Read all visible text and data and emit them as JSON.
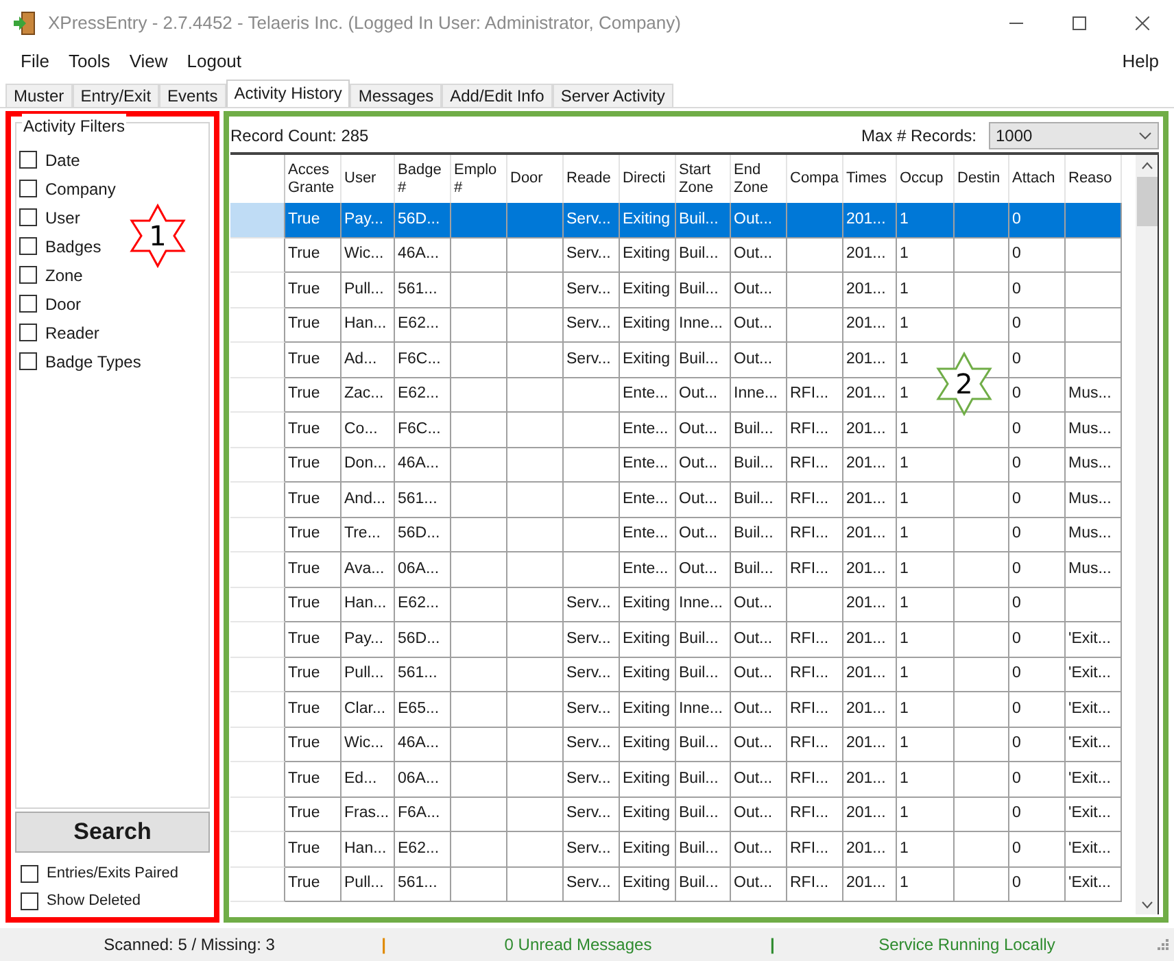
{
  "window": {
    "title": "XPressEntry - 2.7.4452 - Telaeris Inc. (Logged In User: Administrator, Company)"
  },
  "menu": {
    "items": [
      "File",
      "Tools",
      "View",
      "Logout"
    ],
    "help": "Help"
  },
  "tabs": [
    {
      "label": "Muster",
      "selected": false
    },
    {
      "label": "Entry/Exit",
      "selected": false
    },
    {
      "label": "Events",
      "selected": false
    },
    {
      "label": "Activity History",
      "selected": true
    },
    {
      "label": "Messages",
      "selected": false
    },
    {
      "label": "Add/Edit Info",
      "selected": false
    },
    {
      "label": "Server Activity",
      "selected": false
    }
  ],
  "filters": {
    "title": "Activity Filters",
    "items": [
      {
        "label": "Date",
        "checked": false
      },
      {
        "label": "Company",
        "checked": false
      },
      {
        "label": "User",
        "checked": false
      },
      {
        "label": "Badges",
        "checked": false
      },
      {
        "label": "Zone",
        "checked": false
      },
      {
        "label": "Door",
        "checked": false
      },
      {
        "label": "Reader",
        "checked": false
      },
      {
        "label": "Badge Types",
        "checked": false
      }
    ],
    "search_button": "Search",
    "options": [
      {
        "label": "Entries/Exits Paired",
        "checked": false
      },
      {
        "label": "Show Deleted",
        "checked": false
      }
    ]
  },
  "records": {
    "count_label": "Record Count: 285",
    "max_label": "Max # Records:",
    "max_value": "1000"
  },
  "table": {
    "columns": [
      "Acces Grante",
      "User",
      "Badge #",
      "Emplo #",
      "Door",
      "Reade",
      "Directi",
      "Start Zone",
      "End Zone",
      "Compa",
      "Times",
      "Occup",
      "Destin",
      "Attach",
      "Reaso"
    ],
    "rows": [
      {
        "selected": true,
        "cells": [
          "True",
          "Pay...",
          "56D...",
          "",
          "",
          "Serv...",
          "Exiting",
          "Buil...",
          "Out...",
          "",
          "201...",
          "1",
          "",
          "0",
          ""
        ]
      },
      {
        "selected": false,
        "cells": [
          "True",
          "Wic...",
          "46A...",
          "",
          "",
          "Serv...",
          "Exiting",
          "Buil...",
          "Out...",
          "",
          "201...",
          "1",
          "",
          "0",
          ""
        ]
      },
      {
        "selected": false,
        "cells": [
          "True",
          "Pull...",
          "561...",
          "",
          "",
          "Serv...",
          "Exiting",
          "Buil...",
          "Out...",
          "",
          "201...",
          "1",
          "",
          "0",
          ""
        ]
      },
      {
        "selected": false,
        "cells": [
          "True",
          "Han...",
          "E62...",
          "",
          "",
          "Serv...",
          "Exiting",
          "Inne...",
          "Out...",
          "",
          "201...",
          "1",
          "",
          "0",
          ""
        ]
      },
      {
        "selected": false,
        "cells": [
          "True",
          "Ad...",
          "F6C...",
          "",
          "",
          "Serv...",
          "Exiting",
          "Buil...",
          "Out...",
          "",
          "201...",
          "1",
          "",
          "0",
          ""
        ]
      },
      {
        "selected": false,
        "cells": [
          "True",
          "Zac...",
          "E62...",
          "",
          "",
          "",
          "Ente...",
          "Out...",
          "Inne...",
          "RFI...",
          "201...",
          "1",
          "",
          "0",
          "Mus..."
        ]
      },
      {
        "selected": false,
        "cells": [
          "True",
          "Co...",
          "F6C...",
          "",
          "",
          "",
          "Ente...",
          "Out...",
          "Buil...",
          "RFI...",
          "201...",
          "1",
          "",
          "0",
          "Mus..."
        ]
      },
      {
        "selected": false,
        "cells": [
          "True",
          "Don...",
          "46A...",
          "",
          "",
          "",
          "Ente...",
          "Out...",
          "Buil...",
          "RFI...",
          "201...",
          "1",
          "",
          "0",
          "Mus..."
        ]
      },
      {
        "selected": false,
        "cells": [
          "True",
          "And...",
          "561...",
          "",
          "",
          "",
          "Ente...",
          "Out...",
          "Buil...",
          "RFI...",
          "201...",
          "1",
          "",
          "0",
          "Mus..."
        ]
      },
      {
        "selected": false,
        "cells": [
          "True",
          "Tre...",
          "56D...",
          "",
          "",
          "",
          "Ente...",
          "Out...",
          "Buil...",
          "RFI...",
          "201...",
          "1",
          "",
          "0",
          "Mus..."
        ]
      },
      {
        "selected": false,
        "cells": [
          "True",
          "Ava...",
          "06A...",
          "",
          "",
          "",
          "Ente...",
          "Out...",
          "Buil...",
          "RFI...",
          "201...",
          "1",
          "",
          "0",
          "Mus..."
        ]
      },
      {
        "selected": false,
        "cells": [
          "True",
          "Han...",
          "E62...",
          "",
          "",
          "Serv...",
          "Exiting",
          "Inne...",
          "Out...",
          "",
          "201...",
          "1",
          "",
          "0",
          ""
        ]
      },
      {
        "selected": false,
        "cells": [
          "True",
          "Pay...",
          "56D...",
          "",
          "",
          "Serv...",
          "Exiting",
          "Buil...",
          "Out...",
          "RFI...",
          "201...",
          "1",
          "",
          "0",
          "'Exit..."
        ]
      },
      {
        "selected": false,
        "cells": [
          "True",
          "Pull...",
          "561...",
          "",
          "",
          "Serv...",
          "Exiting",
          "Buil...",
          "Out...",
          "RFI...",
          "201...",
          "1",
          "",
          "0",
          "'Exit..."
        ]
      },
      {
        "selected": false,
        "cells": [
          "True",
          "Clar...",
          "E65...",
          "",
          "",
          "Serv...",
          "Exiting",
          "Inne...",
          "Out...",
          "RFI...",
          "201...",
          "1",
          "",
          "0",
          "'Exit..."
        ]
      },
      {
        "selected": false,
        "cells": [
          "True",
          "Wic...",
          "46A...",
          "",
          "",
          "Serv...",
          "Exiting",
          "Buil...",
          "Out...",
          "RFI...",
          "201...",
          "1",
          "",
          "0",
          "'Exit..."
        ]
      },
      {
        "selected": false,
        "cells": [
          "True",
          "Ed...",
          "06A...",
          "",
          "",
          "Serv...",
          "Exiting",
          "Buil...",
          "Out...",
          "RFI...",
          "201...",
          "1",
          "",
          "0",
          "'Exit..."
        ]
      },
      {
        "selected": false,
        "cells": [
          "True",
          "Fras...",
          "F6A...",
          "",
          "",
          "Serv...",
          "Exiting",
          "Buil...",
          "Out...",
          "RFI...",
          "201...",
          "1",
          "",
          "0",
          "'Exit..."
        ]
      },
      {
        "selected": false,
        "cells": [
          "True",
          "Han...",
          "E62...",
          "",
          "",
          "Serv...",
          "Exiting",
          "Buil...",
          "Out...",
          "RFI...",
          "201...",
          "1",
          "",
          "0",
          "'Exit..."
        ]
      },
      {
        "selected": false,
        "cells": [
          "True",
          "Pull...",
          "561...",
          "",
          "",
          "Serv...",
          "Exiting",
          "Buil...",
          "Out...",
          "RFI...",
          "201...",
          "1",
          "",
          "0",
          "'Exit..."
        ]
      }
    ]
  },
  "annotations": [
    {
      "label": "1",
      "color": "#ff0000"
    },
    {
      "label": "2",
      "color": "#70ad47"
    }
  ],
  "status_bar": [
    {
      "kind": "text",
      "text": "Scanned: 5 / Missing: 3",
      "color": "#1a1a1a"
    },
    {
      "kind": "separator",
      "text": "|",
      "color": "#e08a00"
    },
    {
      "kind": "text",
      "text": "0 Unread Messages",
      "color": "#2e8b2e"
    },
    {
      "kind": "separator",
      "text": "|",
      "color": "#2e8b2e"
    },
    {
      "kind": "text",
      "text": "Service Running Locally",
      "color": "#2e8b2e"
    }
  ]
}
